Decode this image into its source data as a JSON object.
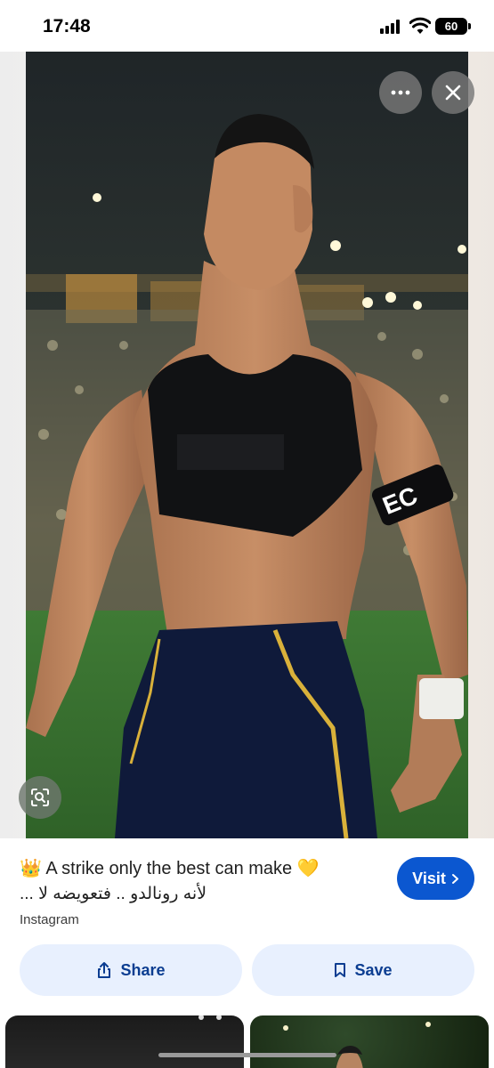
{
  "status_bar": {
    "time": "17:48",
    "battery": "60",
    "icons": [
      "signal-icon",
      "wifi-icon",
      "battery-icon"
    ]
  },
  "viewer": {
    "overlay_buttons": [
      "more-icon",
      "close-icon",
      "lens-icon"
    ],
    "photo_text": "EC"
  },
  "pin": {
    "title_emoji": "👑",
    "title": "A strike only the best can make",
    "title_end_emoji": "💛",
    "subtitle": "... لأنه رونالدو .. فتعويضه لا",
    "source": "Instagram",
    "visit_label": "Visit",
    "share_label": "Share",
    "save_label": "Save"
  },
  "colors": {
    "accent": "#0b57d0",
    "pill_bg": "#e8f0fe",
    "pill_text": "#0b3d91"
  }
}
